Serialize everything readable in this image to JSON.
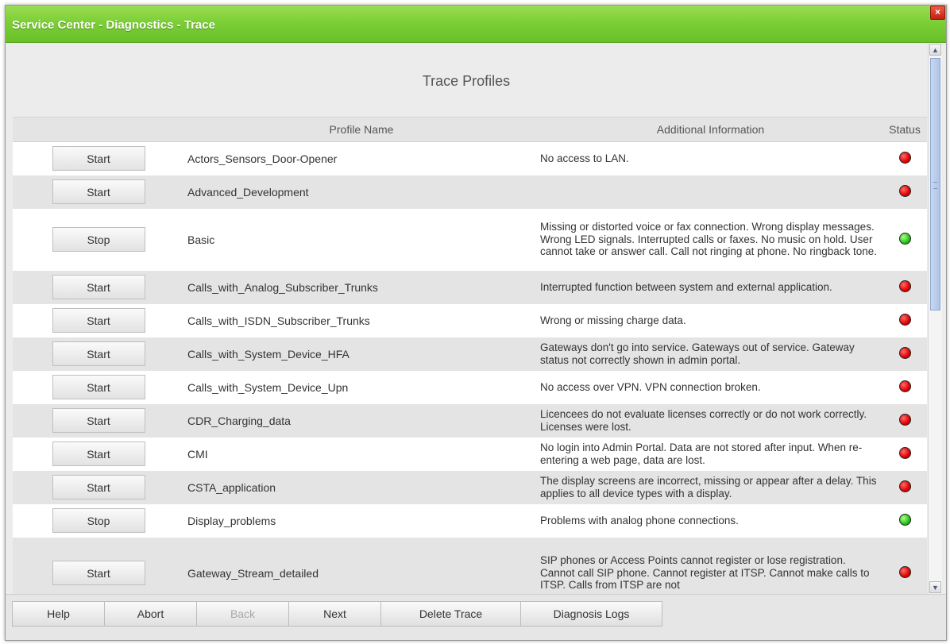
{
  "window": {
    "title": "Service Center - Diagnostics - Trace",
    "close_symbol": "×"
  },
  "page": {
    "heading": "Trace Profiles"
  },
  "table": {
    "headers": {
      "button": "",
      "profile_name": "Profile Name",
      "additional_info": "Additional Information",
      "status": "Status"
    },
    "rows": [
      {
        "button": "Start",
        "name": "Actors_Sensors_Door-Opener",
        "info": "No access to LAN.",
        "status": "red"
      },
      {
        "button": "Start",
        "name": "Advanced_Development",
        "info": "",
        "status": "red"
      },
      {
        "button": "Stop",
        "name": "Basic",
        "info": "Missing or distorted voice or fax connection. Wrong display messages. Wrong LED signals. Interrupted calls or faxes. No music on hold. User cannot take or answer call. Call not ringing at phone. No ringback tone.",
        "status": "green"
      },
      {
        "button": "Start",
        "name": "Calls_with_Analog_Subscriber_Trunks",
        "info": "Interrupted function between system and external application.",
        "status": "red"
      },
      {
        "button": "Start",
        "name": "Calls_with_ISDN_Subscriber_Trunks",
        "info": "Wrong or missing charge data.",
        "status": "red"
      },
      {
        "button": "Start",
        "name": "Calls_with_System_Device_HFA",
        "info": "Gateways don't go into service. Gateways out of service. Gateway status not correctly shown in admin portal.",
        "status": "red"
      },
      {
        "button": "Start",
        "name": "Calls_with_System_Device_Upn",
        "info": "No access over VPN. VPN connection broken.",
        "status": "red"
      },
      {
        "button": "Start",
        "name": "CDR_Charging_data",
        "info": "Licencees do not evaluate licenses correctly or do not work correctly. Licenses were lost.",
        "status": "red"
      },
      {
        "button": "Start",
        "name": "CMI",
        "info": "No login into Admin Portal. Data are not stored after input. When re-entering a web page, data are lost.",
        "status": "red"
      },
      {
        "button": "Start",
        "name": "CSTA_application",
        "info": "The display screens are incorrect, missing or appear after a delay. This applies to all device types with a display.",
        "status": "red"
      },
      {
        "button": "Stop",
        "name": "Display_problems",
        "info": "Problems with analog phone connections.",
        "status": "green"
      },
      {
        "button": "Start",
        "name": "Gateway_Stream_detailed",
        "info": "SIP phones or Access Points cannot register or lose registration. Cannot call SIP phone. Cannot register at ITSP. Cannot make calls to ITSP. Calls from ITSP are not",
        "status": "red"
      }
    ]
  },
  "scrollbar": {
    "up_symbol": "▲",
    "down_symbol": "▼"
  },
  "footer": {
    "buttons": [
      {
        "label": "Help",
        "enabled": true
      },
      {
        "label": "Abort",
        "enabled": true
      },
      {
        "label": "Back",
        "enabled": false
      },
      {
        "label": "Next",
        "enabled": true
      },
      {
        "label": "Delete Trace",
        "enabled": true
      },
      {
        "label": "Diagnosis Logs",
        "enabled": true
      }
    ]
  },
  "colors": {
    "title_bar": "#7ccf35",
    "status_red": "#e00000",
    "status_green": "#22c21a"
  }
}
